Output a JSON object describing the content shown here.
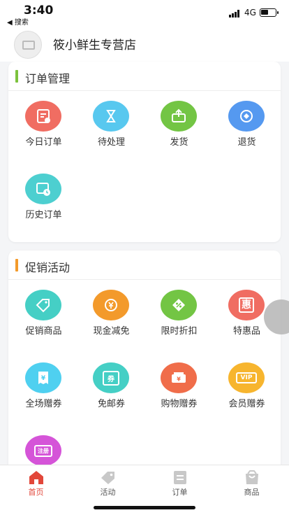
{
  "status": {
    "time": "3:40",
    "back_label": "◀ 搜索",
    "network": "4G"
  },
  "store": {
    "name": "筱小鲜生专营店"
  },
  "sections": [
    {
      "title": "订单管理",
      "accent_color": "#7cc23d",
      "items": [
        {
          "label": "今日订单",
          "icon": "order-today-icon",
          "color": "#f06d62"
        },
        {
          "label": "待处理",
          "icon": "hourglass-icon",
          "color": "#58c8ef"
        },
        {
          "label": "发货",
          "icon": "ship-box-icon",
          "color": "#73c544"
        },
        {
          "label": "退货",
          "icon": "return-icon",
          "color": "#5599f0"
        },
        {
          "label": "历史订单",
          "icon": "history-order-icon",
          "color": "#4dcfd0"
        }
      ]
    },
    {
      "title": "促销活动",
      "accent_color": "#f39a2b",
      "items": [
        {
          "label": "促销商品",
          "icon": "promo-tag-icon",
          "color": "#45cfc5"
        },
        {
          "label": "现金减免",
          "icon": "cash-coin-icon",
          "color": "#f39a2b"
        },
        {
          "label": "限时折扣",
          "icon": "discount-icon",
          "color": "#73c544"
        },
        {
          "label": "特惠品",
          "icon": "special-offer-icon",
          "color": "#f06d62",
          "glyph": "惠"
        },
        {
          "label": "全场赠券",
          "icon": "full-store-coupon-icon",
          "color": "#4fd0f0"
        },
        {
          "label": "免邮券",
          "icon": "free-shipping-coupon-icon",
          "color": "#45cfc5",
          "glyph": "券"
        },
        {
          "label": "购物赠券",
          "icon": "shopping-coupon-icon",
          "color": "#f06d4a"
        },
        {
          "label": "会员赠券",
          "icon": "vip-coupon-icon",
          "color": "#f7b52e",
          "glyph": "VIP"
        },
        {
          "label": "",
          "icon": "register-gift-icon",
          "color": "#d554d8",
          "glyph": "注册"
        }
      ]
    }
  ],
  "tabbar": {
    "items": [
      {
        "label": "首页",
        "icon": "home-icon",
        "active": true
      },
      {
        "label": "活动",
        "icon": "tag-icon",
        "active": false
      },
      {
        "label": "订单",
        "icon": "order-list-icon",
        "active": false
      },
      {
        "label": "商品",
        "icon": "goods-icon",
        "active": false
      }
    ],
    "active_color": "#e2473a"
  }
}
